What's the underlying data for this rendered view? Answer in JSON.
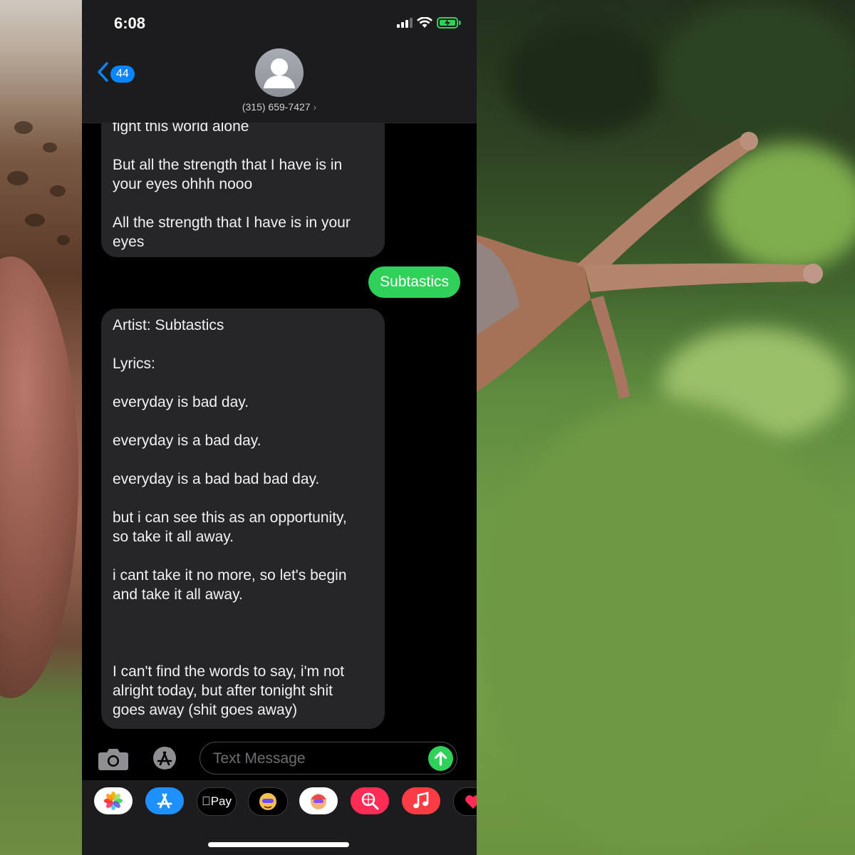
{
  "status_bar": {
    "time": "6:08"
  },
  "header": {
    "back_count": "44",
    "contact_number": "(315) 659-7427",
    "contact_chevron": "›"
  },
  "messages": [
    {
      "direction": "incoming",
      "paragraphs": [
        "fight this world alone",
        "But all the strength that I have is in\nyour eyes ohhh nooo",
        "All the strength that I have is in your\neyes"
      ]
    },
    {
      "direction": "outgoing",
      "text": "Subtastics"
    },
    {
      "direction": "incoming",
      "paragraphs": [
        "Artist: Subtastics",
        "Lyrics:",
        "everyday is bad day.",
        "everyday is a bad day.",
        "everyday is a bad bad bad day.",
        "but i can see this as an opportunity,\nso take it all away.",
        "i cant take it no more, so let's begin\nand take it all away.",
        "I can't find the words to say, i'm not\nalright today, but after tonight shit\ngoes away (shit goes away)"
      ]
    }
  ],
  "composer": {
    "placeholder": "Text Message"
  },
  "app_tray": {
    "items": [
      {
        "name": "photos-icon"
      },
      {
        "name": "app-store-icon"
      },
      {
        "name": "apple-pay",
        "label": "Pay"
      },
      {
        "name": "memoji-icon"
      },
      {
        "name": "memoji-stickers-icon"
      },
      {
        "name": "search-images-icon"
      },
      {
        "name": "music-icon"
      },
      {
        "name": "digital-touch-icon"
      }
    ]
  },
  "colors": {
    "accent_blue": "#0a84ff",
    "imessage_green": "#30d158",
    "incoming_bubble": "#262628",
    "bar_bg": "#1c1c1e"
  }
}
